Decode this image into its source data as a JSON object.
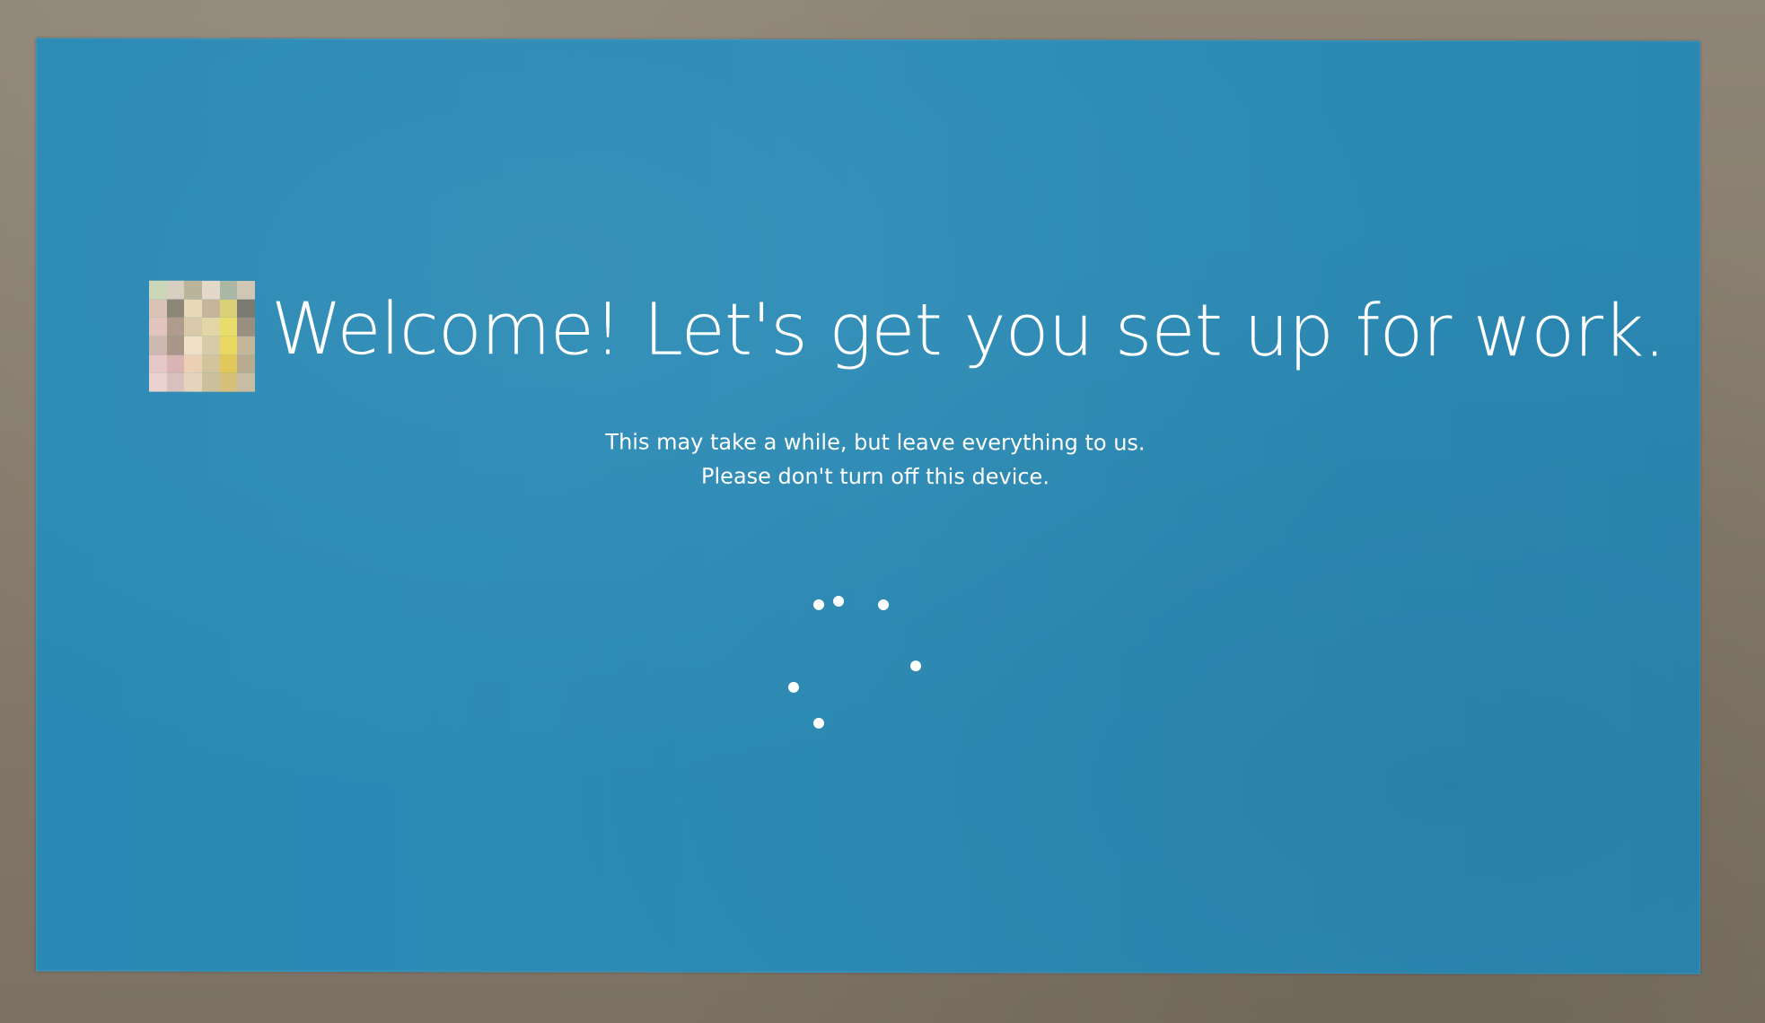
{
  "screen": {
    "headline": "Welcome! Let's get you set up for work.",
    "subtitle_line1": "This may take a while, but leave everything to us.",
    "subtitle_line2": "Please don't turn off this device.",
    "background_color": "#2b8ab5",
    "text_color": "#ffffff"
  },
  "avatar": {
    "icon": "user-avatar-icon",
    "pixelated": true
  },
  "spinner": {
    "icon": "loading-spinner-icon",
    "dot_count": 6
  }
}
